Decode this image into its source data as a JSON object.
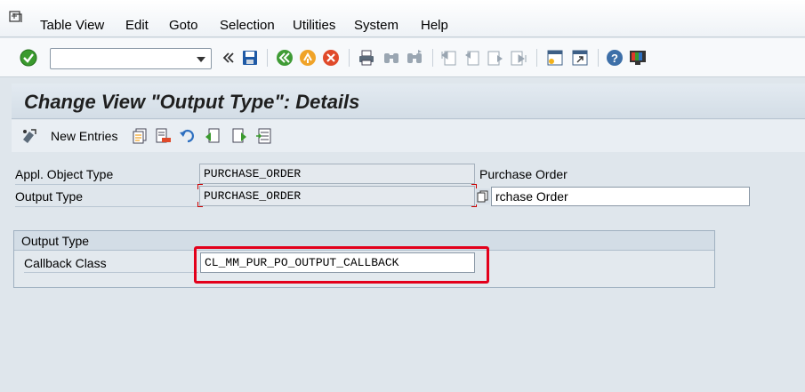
{
  "menubar": {
    "items": [
      {
        "label": "Table View"
      },
      {
        "label": "Edit"
      },
      {
        "label": "Goto"
      },
      {
        "label": "Selection"
      },
      {
        "label": "Utilities"
      },
      {
        "label": "System"
      },
      {
        "label": "Help"
      }
    ]
  },
  "system_toolbar": {
    "command_field_value": "",
    "icons": [
      "enter-icon",
      "back-double-arrow-icon",
      "save-icon",
      "back-icon",
      "exit-icon",
      "cancel-icon",
      "print-icon",
      "find-icon",
      "find-next-icon",
      "first-page-icon",
      "previous-page-icon",
      "next-page-icon",
      "last-page-icon",
      "new-session-icon",
      "shortcut-icon",
      "help-icon",
      "customize-layout-icon"
    ]
  },
  "title": "Change View \"Output Type\": Details",
  "app_toolbar": {
    "new_entries_label": "New Entries"
  },
  "form": {
    "appl_object_type_label": "Appl. Object Type",
    "appl_object_type_value": "PURCHASE_ORDER",
    "appl_object_type_desc": "Purchase Order",
    "output_type_label": "Output Type",
    "output_type_value": "PURCHASE_ORDER",
    "output_type_desc": "rchase Order"
  },
  "group": {
    "title": "Output Type",
    "callback_label": "Callback Class",
    "callback_value": "CL_MM_PUR_PO_OUTPUT_CALLBACK"
  },
  "colors": {
    "highlight": "#e3001b",
    "title_bg": "#d3dde6",
    "enter_green": "#3a9a2e",
    "save_blue": "#1f5aa6"
  }
}
